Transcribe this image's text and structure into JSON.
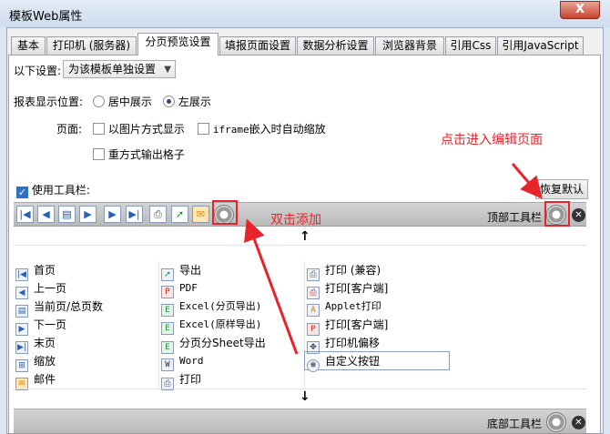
{
  "window": {
    "title": "模板Web属性",
    "close": "X"
  },
  "tabs": [
    "基本",
    "打印机 (服务器)",
    "分页预览设置",
    "填报页面设置",
    "数据分析设置",
    "浏览器背景",
    "引用Css",
    "引用JavaScript"
  ],
  "settings": {
    "scope_label": "以下设置:",
    "scope_value": "为该模板单独设置",
    "position_label": "报表显示位置:",
    "position_center": "居中展示",
    "position_left": "左展示",
    "page_label": "页面:",
    "opt_image": "以图片方式显示",
    "opt_iframe_code": "iframe",
    "opt_iframe_text": "嵌入时自动缩放",
    "opt_grid": "重方式输出格子"
  },
  "toolbar": {
    "use_label": "使用工具栏:",
    "restore_button": "恢复默认",
    "top_label": "顶部工具栏",
    "bottom_label": "底部工具栏",
    "up_arrow": "↑",
    "down_arrow": "↓"
  },
  "items": {
    "c1": [
      "首页",
      "上一页",
      "当前页/总页数",
      "下一页",
      "末页",
      "缩放",
      "邮件"
    ],
    "c2": [
      "导出",
      "PDF",
      "Excel(分页导出)",
      "Excel(原样导出)",
      "分页分Sheet导出",
      "Word",
      "打印"
    ],
    "c3": [
      "打印 (兼容)",
      "打印[客户端]",
      "Applet打印",
      "打印[客户端]",
      "打印机偏移",
      "自定义按钮"
    ]
  },
  "annotations": {
    "enter_edit": "点击进入编辑页面",
    "double_click_add": "双击添加"
  },
  "colors": {
    "annotation": "#e8242b",
    "toolbar": "#c4c4c4",
    "title_bg": "#dce6f2"
  }
}
